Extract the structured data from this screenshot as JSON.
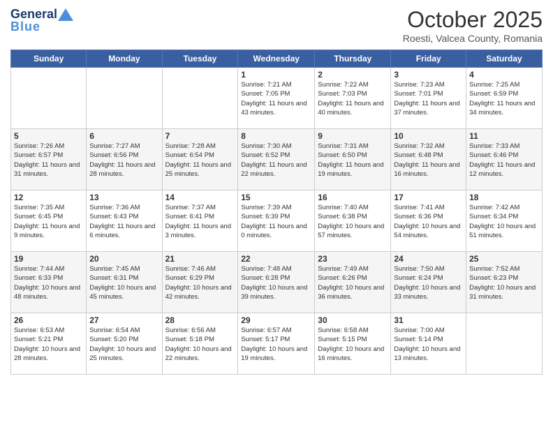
{
  "header": {
    "logo_line1": "General",
    "logo_line2": "Blue",
    "month": "October 2025",
    "location": "Roesti, Valcea County, Romania"
  },
  "weekdays": [
    "Sunday",
    "Monday",
    "Tuesday",
    "Wednesday",
    "Thursday",
    "Friday",
    "Saturday"
  ],
  "weeks": [
    [
      {
        "day": "",
        "sunrise": "",
        "sunset": "",
        "daylight": ""
      },
      {
        "day": "",
        "sunrise": "",
        "sunset": "",
        "daylight": ""
      },
      {
        "day": "",
        "sunrise": "",
        "sunset": "",
        "daylight": ""
      },
      {
        "day": "1",
        "sunrise": "Sunrise: 7:21 AM",
        "sunset": "Sunset: 7:05 PM",
        "daylight": "Daylight: 11 hours and 43 minutes."
      },
      {
        "day": "2",
        "sunrise": "Sunrise: 7:22 AM",
        "sunset": "Sunset: 7:03 PM",
        "daylight": "Daylight: 11 hours and 40 minutes."
      },
      {
        "day": "3",
        "sunrise": "Sunrise: 7:23 AM",
        "sunset": "Sunset: 7:01 PM",
        "daylight": "Daylight: 11 hours and 37 minutes."
      },
      {
        "day": "4",
        "sunrise": "Sunrise: 7:25 AM",
        "sunset": "Sunset: 6:59 PM",
        "daylight": "Daylight: 11 hours and 34 minutes."
      }
    ],
    [
      {
        "day": "5",
        "sunrise": "Sunrise: 7:26 AM",
        "sunset": "Sunset: 6:57 PM",
        "daylight": "Daylight: 11 hours and 31 minutes."
      },
      {
        "day": "6",
        "sunrise": "Sunrise: 7:27 AM",
        "sunset": "Sunset: 6:56 PM",
        "daylight": "Daylight: 11 hours and 28 minutes."
      },
      {
        "day": "7",
        "sunrise": "Sunrise: 7:28 AM",
        "sunset": "Sunset: 6:54 PM",
        "daylight": "Daylight: 11 hours and 25 minutes."
      },
      {
        "day": "8",
        "sunrise": "Sunrise: 7:30 AM",
        "sunset": "Sunset: 6:52 PM",
        "daylight": "Daylight: 11 hours and 22 minutes."
      },
      {
        "day": "9",
        "sunrise": "Sunrise: 7:31 AM",
        "sunset": "Sunset: 6:50 PM",
        "daylight": "Daylight: 11 hours and 19 minutes."
      },
      {
        "day": "10",
        "sunrise": "Sunrise: 7:32 AM",
        "sunset": "Sunset: 6:48 PM",
        "daylight": "Daylight: 11 hours and 16 minutes."
      },
      {
        "day": "11",
        "sunrise": "Sunrise: 7:33 AM",
        "sunset": "Sunset: 6:46 PM",
        "daylight": "Daylight: 11 hours and 12 minutes."
      }
    ],
    [
      {
        "day": "12",
        "sunrise": "Sunrise: 7:35 AM",
        "sunset": "Sunset: 6:45 PM",
        "daylight": "Daylight: 11 hours and 9 minutes."
      },
      {
        "day": "13",
        "sunrise": "Sunrise: 7:36 AM",
        "sunset": "Sunset: 6:43 PM",
        "daylight": "Daylight: 11 hours and 6 minutes."
      },
      {
        "day": "14",
        "sunrise": "Sunrise: 7:37 AM",
        "sunset": "Sunset: 6:41 PM",
        "daylight": "Daylight: 11 hours and 3 minutes."
      },
      {
        "day": "15",
        "sunrise": "Sunrise: 7:39 AM",
        "sunset": "Sunset: 6:39 PM",
        "daylight": "Daylight: 11 hours and 0 minutes."
      },
      {
        "day": "16",
        "sunrise": "Sunrise: 7:40 AM",
        "sunset": "Sunset: 6:38 PM",
        "daylight": "Daylight: 10 hours and 57 minutes."
      },
      {
        "day": "17",
        "sunrise": "Sunrise: 7:41 AM",
        "sunset": "Sunset: 6:36 PM",
        "daylight": "Daylight: 10 hours and 54 minutes."
      },
      {
        "day": "18",
        "sunrise": "Sunrise: 7:42 AM",
        "sunset": "Sunset: 6:34 PM",
        "daylight": "Daylight: 10 hours and 51 minutes."
      }
    ],
    [
      {
        "day": "19",
        "sunrise": "Sunrise: 7:44 AM",
        "sunset": "Sunset: 6:33 PM",
        "daylight": "Daylight: 10 hours and 48 minutes."
      },
      {
        "day": "20",
        "sunrise": "Sunrise: 7:45 AM",
        "sunset": "Sunset: 6:31 PM",
        "daylight": "Daylight: 10 hours and 45 minutes."
      },
      {
        "day": "21",
        "sunrise": "Sunrise: 7:46 AM",
        "sunset": "Sunset: 6:29 PM",
        "daylight": "Daylight: 10 hours and 42 minutes."
      },
      {
        "day": "22",
        "sunrise": "Sunrise: 7:48 AM",
        "sunset": "Sunset: 6:28 PM",
        "daylight": "Daylight: 10 hours and 39 minutes."
      },
      {
        "day": "23",
        "sunrise": "Sunrise: 7:49 AM",
        "sunset": "Sunset: 6:26 PM",
        "daylight": "Daylight: 10 hours and 36 minutes."
      },
      {
        "day": "24",
        "sunrise": "Sunrise: 7:50 AM",
        "sunset": "Sunset: 6:24 PM",
        "daylight": "Daylight: 10 hours and 33 minutes."
      },
      {
        "day": "25",
        "sunrise": "Sunrise: 7:52 AM",
        "sunset": "Sunset: 6:23 PM",
        "daylight": "Daylight: 10 hours and 31 minutes."
      }
    ],
    [
      {
        "day": "26",
        "sunrise": "Sunrise: 6:53 AM",
        "sunset": "Sunset: 5:21 PM",
        "daylight": "Daylight: 10 hours and 28 minutes."
      },
      {
        "day": "27",
        "sunrise": "Sunrise: 6:54 AM",
        "sunset": "Sunset: 5:20 PM",
        "daylight": "Daylight: 10 hours and 25 minutes."
      },
      {
        "day": "28",
        "sunrise": "Sunrise: 6:56 AM",
        "sunset": "Sunset: 5:18 PM",
        "daylight": "Daylight: 10 hours and 22 minutes."
      },
      {
        "day": "29",
        "sunrise": "Sunrise: 6:57 AM",
        "sunset": "Sunset: 5:17 PM",
        "daylight": "Daylight: 10 hours and 19 minutes."
      },
      {
        "day": "30",
        "sunrise": "Sunrise: 6:58 AM",
        "sunset": "Sunset: 5:15 PM",
        "daylight": "Daylight: 10 hours and 16 minutes."
      },
      {
        "day": "31",
        "sunrise": "Sunrise: 7:00 AM",
        "sunset": "Sunset: 5:14 PM",
        "daylight": "Daylight: 10 hours and 13 minutes."
      },
      {
        "day": "",
        "sunrise": "",
        "sunset": "",
        "daylight": ""
      }
    ]
  ]
}
